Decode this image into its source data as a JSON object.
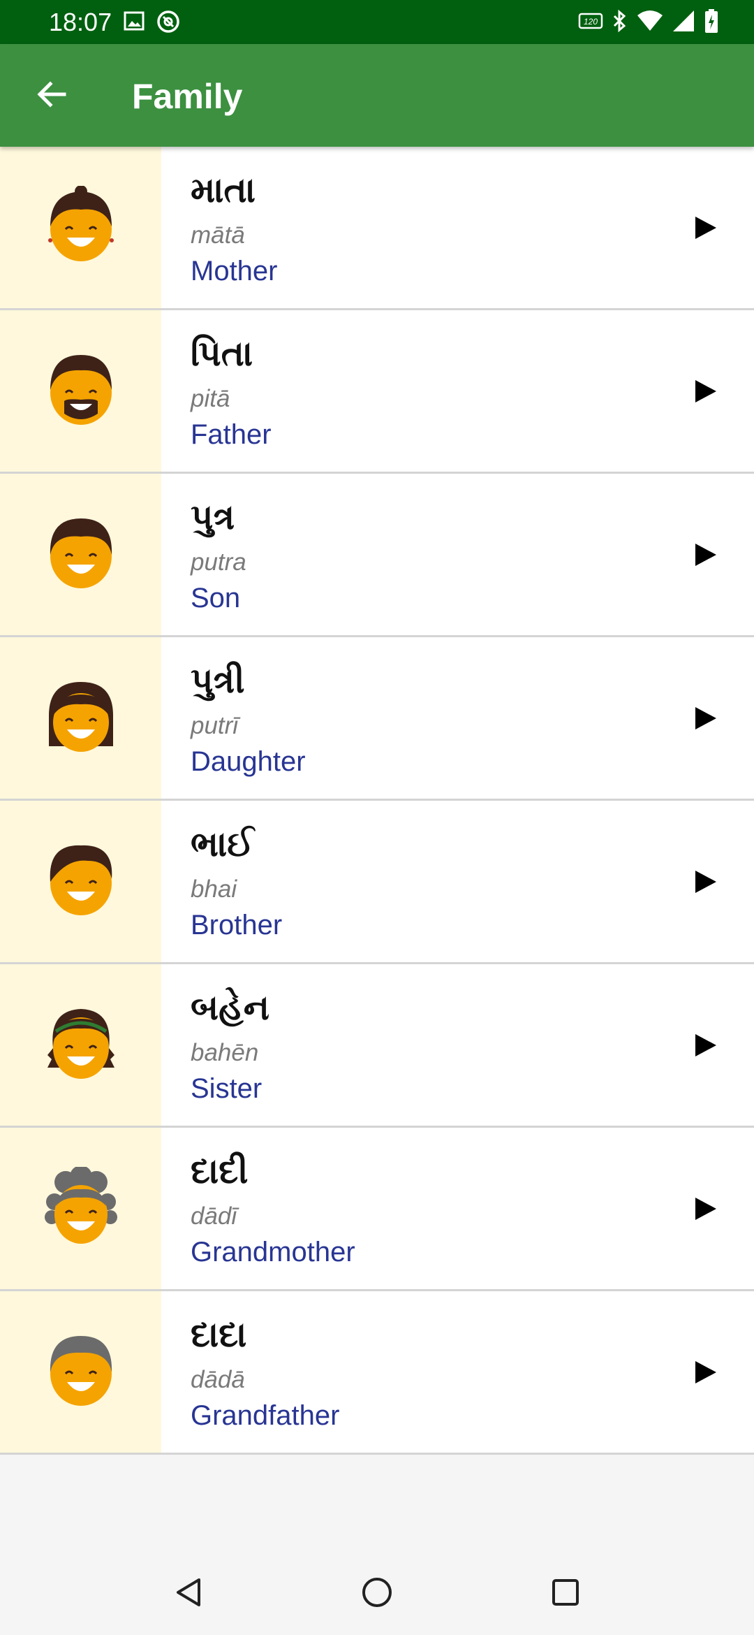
{
  "status_bar": {
    "time": "18:07",
    "icons_left": [
      "image-icon",
      "at-sign-icon"
    ],
    "icons_right": [
      "hd-icon",
      "bluetooth-icon",
      "wifi-icon",
      "signal-icon",
      "battery-charging-icon"
    ]
  },
  "app_bar": {
    "title": "Family",
    "back_icon": "arrow-back-icon",
    "color": "#3c9040"
  },
  "colors": {
    "status_bar": "#00600f",
    "avatar_bg": "#fff8dc",
    "english_text": "#283593",
    "translit_text": "#7a7a7a"
  },
  "items": [
    {
      "native": "માતા",
      "translit": "mātā",
      "english": "Mother",
      "avatar": "mother-avatar-icon"
    },
    {
      "native": "પિતા",
      "translit": "pitā",
      "english": "Father",
      "avatar": "father-avatar-icon"
    },
    {
      "native": "પુત્ર",
      "translit": "putra",
      "english": "Son",
      "avatar": "son-avatar-icon"
    },
    {
      "native": "પુત્રી",
      "translit": "putrī",
      "english": "Daughter",
      "avatar": "daughter-avatar-icon"
    },
    {
      "native": "ભાઈ",
      "translit": "bhai",
      "english": "Brother",
      "avatar": "brother-avatar-icon"
    },
    {
      "native": "બહેન",
      "translit": "bahēn",
      "english": "Sister",
      "avatar": "sister-avatar-icon"
    },
    {
      "native": "દાદી",
      "translit": "dādī",
      "english": "Grandmother",
      "avatar": "grandmother-avatar-icon"
    },
    {
      "native": "દાદા",
      "translit": "dādā",
      "english": "Grandfather",
      "avatar": "grandfather-avatar-icon"
    }
  ],
  "nav_bar": {
    "icons": [
      "nav-back-icon",
      "nav-home-icon",
      "nav-recents-icon"
    ]
  }
}
